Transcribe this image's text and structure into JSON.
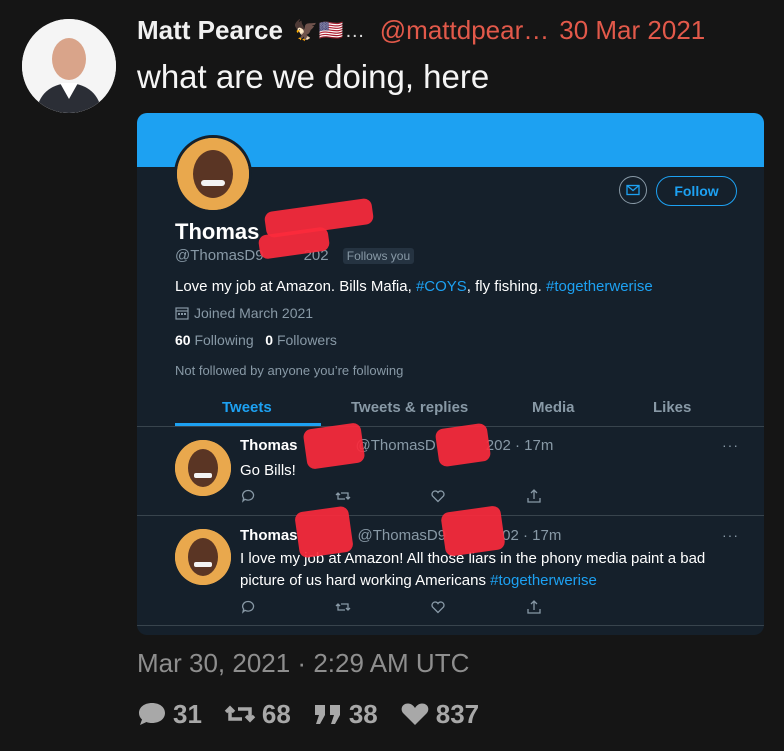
{
  "author": {
    "name": "Matt Pearce",
    "flags": "🦅🇺🇸…",
    "handle": "@mattdpear…",
    "date": "30 Mar 2021"
  },
  "tweet": {
    "text": "what are we doing, here",
    "timestamp": "Mar 30, 2021 · 2:29 AM UTC",
    "stats": {
      "replies": "31",
      "retweets": "68",
      "quotes": "38",
      "likes": "837"
    }
  },
  "embedded": {
    "follow_label": "Follow",
    "profile_name": "Thomas",
    "profile_handle_start": "@ThomasD9",
    "profile_handle_end": "202",
    "follows_you": "Follows you",
    "bio_plain_1": "Love my job at Amazon. Bills Mafia, ",
    "bio_hash_1": "#COYS",
    "bio_plain_2": ", fly fishing. ",
    "bio_hash_2": "#togetherwerise",
    "joined": "Joined March 2021",
    "following_count": "60",
    "following_label": "Following",
    "followers_count": "0",
    "followers_label": "Followers",
    "not_followed": "Not followed by anyone you’re following",
    "tabs": [
      "Tweets",
      "Tweets & replies",
      "Media",
      "Likes"
    ],
    "tweets": [
      {
        "name": "Thomas",
        "handle_start": "@ThomasD",
        "handle_end": "202",
        "time": "· 17m",
        "text_plain": "Go Bills!",
        "text_hash": ""
      },
      {
        "name": "Thomas",
        "handle_start": "@ThomasD9",
        "handle_end": "02",
        "time": "· 17m",
        "text_plain": "I love my job at Amazon! All those liars in the phony media paint a bad picture of us hard working Americans ",
        "text_hash": "#togetherwerise"
      }
    ],
    "more_glyph": "···"
  },
  "colors": {
    "accent_red": "#e2594a",
    "twitter_blue": "#1da1f2",
    "dim_bg": "#15202b"
  }
}
